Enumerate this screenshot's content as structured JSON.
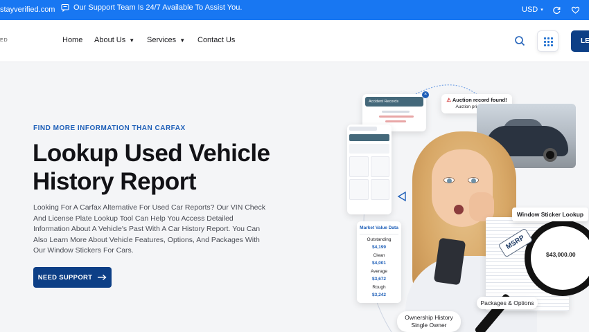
{
  "topbar": {
    "domain_fragment": "stayverified.com",
    "support_text": "Our Support Team Is 24/7 Available To Assist You.",
    "currency": "USD",
    "bg_color": "#1877f2"
  },
  "nav": {
    "logo_fragment": "ED",
    "items": [
      {
        "label": "Home",
        "has_dropdown": false
      },
      {
        "label": "About Us",
        "has_dropdown": true
      },
      {
        "label": "Services",
        "has_dropdown": true
      },
      {
        "label": "Contact Us",
        "has_dropdown": false
      }
    ],
    "cta_label": "LE"
  },
  "hero": {
    "kicker": "FIND MORE INFORMATION THAN CARFAX",
    "title": "Lookup Used Vehicle History Report",
    "description": "Looking For A Carfax Alternative For Used Car Reports? Our VIN Check And License Plate Lookup Tool Can Help You Access Detailed Information About A Vehicle's Past With A Car History Report. You Can Also Learn More About Vehicle Features, Options, And Packages With Our Window Stickers For Cars.",
    "button_label": "NEED SUPPORT",
    "accent_color": "#0d3f86"
  },
  "art": {
    "accident_card_title": "Accident Records",
    "auction_title": "Auction record found!",
    "auction_price": "Auction price: $1,800",
    "market_value": {
      "title": "Market Value Data",
      "rows": [
        {
          "label": "Outstanding",
          "price": "$4,199"
        },
        {
          "label": "Clean",
          "price": "$4,001"
        },
        {
          "label": "Average",
          "price": "$3,672"
        },
        {
          "label": "Rough",
          "price": "$3,242"
        }
      ]
    },
    "window_sticker": "Window Sticker Lookup",
    "msrp_label": "MSRP",
    "msrp_value": "$43,000.00",
    "packages": "Packages & Options",
    "ownership_title": "Ownership History",
    "ownership_value": "Single Owner"
  }
}
